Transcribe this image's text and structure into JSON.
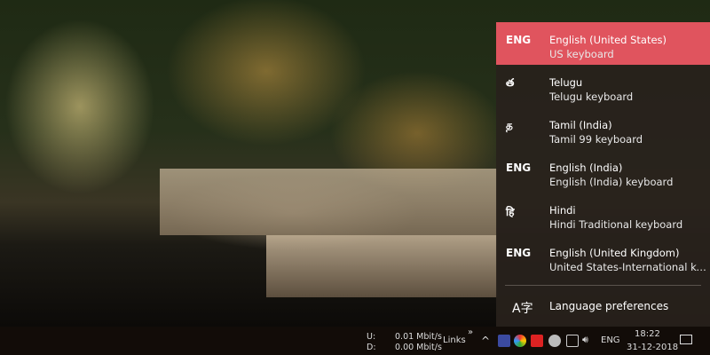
{
  "languages": [
    {
      "abbr": "ENG",
      "name": "English (United States)",
      "keyboard": "US keyboard",
      "selected": true
    },
    {
      "abbr": "త",
      "name": "Telugu",
      "keyboard": "Telugu keyboard"
    },
    {
      "abbr": "த",
      "name": "Tamil (India)",
      "keyboard": "Tamil 99 keyboard"
    },
    {
      "abbr": "ENG",
      "name": "English (India)",
      "keyboard": "English (India) keyboard"
    },
    {
      "abbr": "हि",
      "name": "Hindi",
      "keyboard": "Hindi Traditional keyboard"
    },
    {
      "abbr": "ENG",
      "name": "English (United Kingdom)",
      "keyboard": "United States-International keyboard"
    }
  ],
  "prefs": {
    "icon": "A字",
    "label": "Language preferences"
  },
  "taskbar": {
    "up_label": "U:",
    "down_label": "D:",
    "up_speed": "0.01 Mbit/s",
    "down_speed": "0.00 Mbit/s",
    "links": "Links",
    "chev": "»",
    "overflow": "^",
    "lang": "ENG",
    "time": "18:22",
    "date": "31-12-2018"
  },
  "colors": {
    "accent": "#e0545e"
  }
}
